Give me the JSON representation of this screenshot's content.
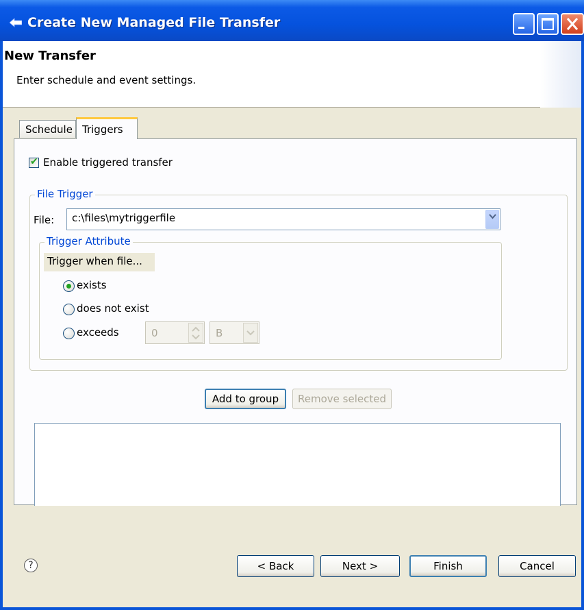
{
  "window": {
    "title": "Create New Managed File Transfer",
    "controls": [
      "minimize",
      "maximize",
      "close"
    ]
  },
  "header": {
    "title": "New Transfer",
    "description": "Enter schedule and event settings."
  },
  "tabs": [
    {
      "label": "Schedule",
      "active": false
    },
    {
      "label": "Triggers",
      "active": true
    }
  ],
  "triggers": {
    "enable_checkbox": {
      "label": "Enable triggered transfer",
      "checked": true
    },
    "file_trigger": {
      "group_label": "File Trigger",
      "file_label": "File:",
      "file_value": "c:\\files\\mytriggerfile",
      "trigger_attribute": {
        "group_label": "Trigger Attribute",
        "caption": "Trigger when file...",
        "options": [
          {
            "label": "exists",
            "selected": true
          },
          {
            "label": "does not exist",
            "selected": false
          },
          {
            "label": "exceeds",
            "selected": false
          }
        ],
        "size_value": "0",
        "unit_value": "B"
      }
    },
    "add_button": "Add to group",
    "remove_button": "Remove selected"
  },
  "footer": {
    "back": "< Back",
    "next": "Next >",
    "finish": "Finish",
    "cancel": "Cancel",
    "help": "?"
  },
  "colors": {
    "titlebar": "#0552dd",
    "group_label": "#0046d5",
    "check": "#21a121",
    "tab_highlight": "#ffc83c"
  }
}
